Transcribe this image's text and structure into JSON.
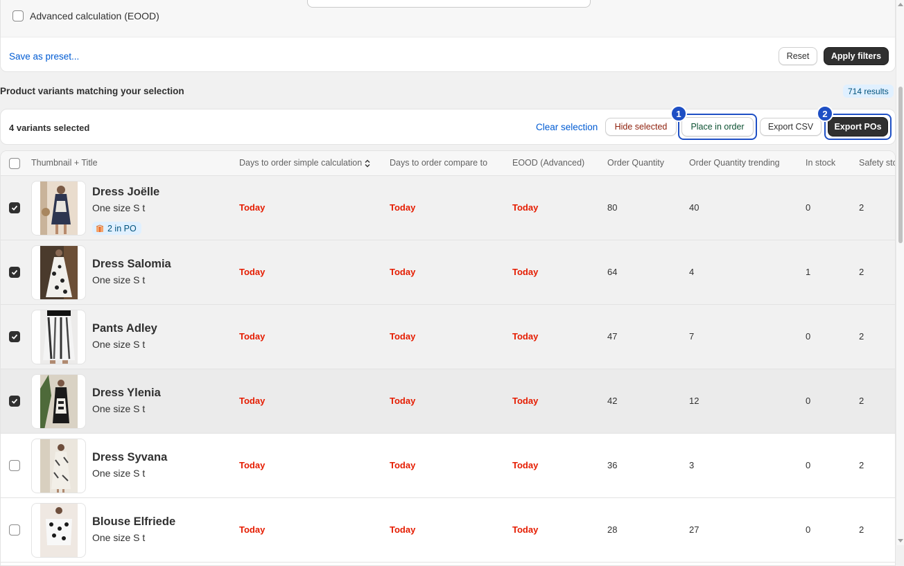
{
  "filters": {
    "advanced_calc_label": "Advanced calculation (EOOD)",
    "save_preset": "Save as preset...",
    "reset": "Reset",
    "apply": "Apply filters"
  },
  "section": {
    "title": "Product variants matching your selection",
    "results": "714 results"
  },
  "selection": {
    "count_label": "4 variants selected",
    "clear": "Clear selection",
    "hide": "Hide selected",
    "place": "Place in order",
    "export_csv": "Export CSV",
    "export_pos": "Export POs",
    "step1": "1",
    "step2": "2"
  },
  "colors": {
    "today": "#e51c00",
    "link": "#005bd3",
    "highlight": "#1e4fc4",
    "hide_text": "#8e1f0b",
    "place_text": "#0c5132"
  },
  "table": {
    "columns": [
      "Thumbnail + Title",
      "Days to order simple calculation",
      "Days to order compare to",
      "EOOD (Advanced)",
      "Order Quantity",
      "Order Quantity trending",
      "In stock",
      "Safety stock"
    ],
    "rows": [
      {
        "title": "Dress Joëlle",
        "variant": "One size S t",
        "badge": "2 in PO",
        "checked": true,
        "simple": "Today",
        "compare": "Today",
        "eood": "Today",
        "qty": "80",
        "trending": "40",
        "stock": "0",
        "safety": "2"
      },
      {
        "title": "Dress Salomia",
        "variant": "One size S t",
        "checked": true,
        "simple": "Today",
        "compare": "Today",
        "eood": "Today",
        "qty": "64",
        "trending": "4",
        "stock": "1",
        "safety": "2"
      },
      {
        "title": "Pants Adley",
        "variant": "One size S t",
        "checked": true,
        "simple": "Today",
        "compare": "Today",
        "eood": "Today",
        "qty": "47",
        "trending": "7",
        "stock": "0",
        "safety": "2"
      },
      {
        "title": "Dress Ylenia",
        "variant": "One size S t",
        "checked": true,
        "simple": "Today",
        "compare": "Today",
        "eood": "Today",
        "qty": "42",
        "trending": "12",
        "stock": "0",
        "safety": "2"
      },
      {
        "title": "Dress Syvana",
        "variant": "One size S t",
        "checked": false,
        "simple": "Today",
        "compare": "Today",
        "eood": "Today",
        "qty": "36",
        "trending": "3",
        "stock": "0",
        "safety": "2"
      },
      {
        "title": "Blouse Elfriede",
        "variant": "One size S t",
        "checked": false,
        "simple": "Today",
        "compare": "Today",
        "eood": "Today",
        "qty": "28",
        "trending": "27",
        "stock": "0",
        "safety": "2"
      }
    ]
  }
}
